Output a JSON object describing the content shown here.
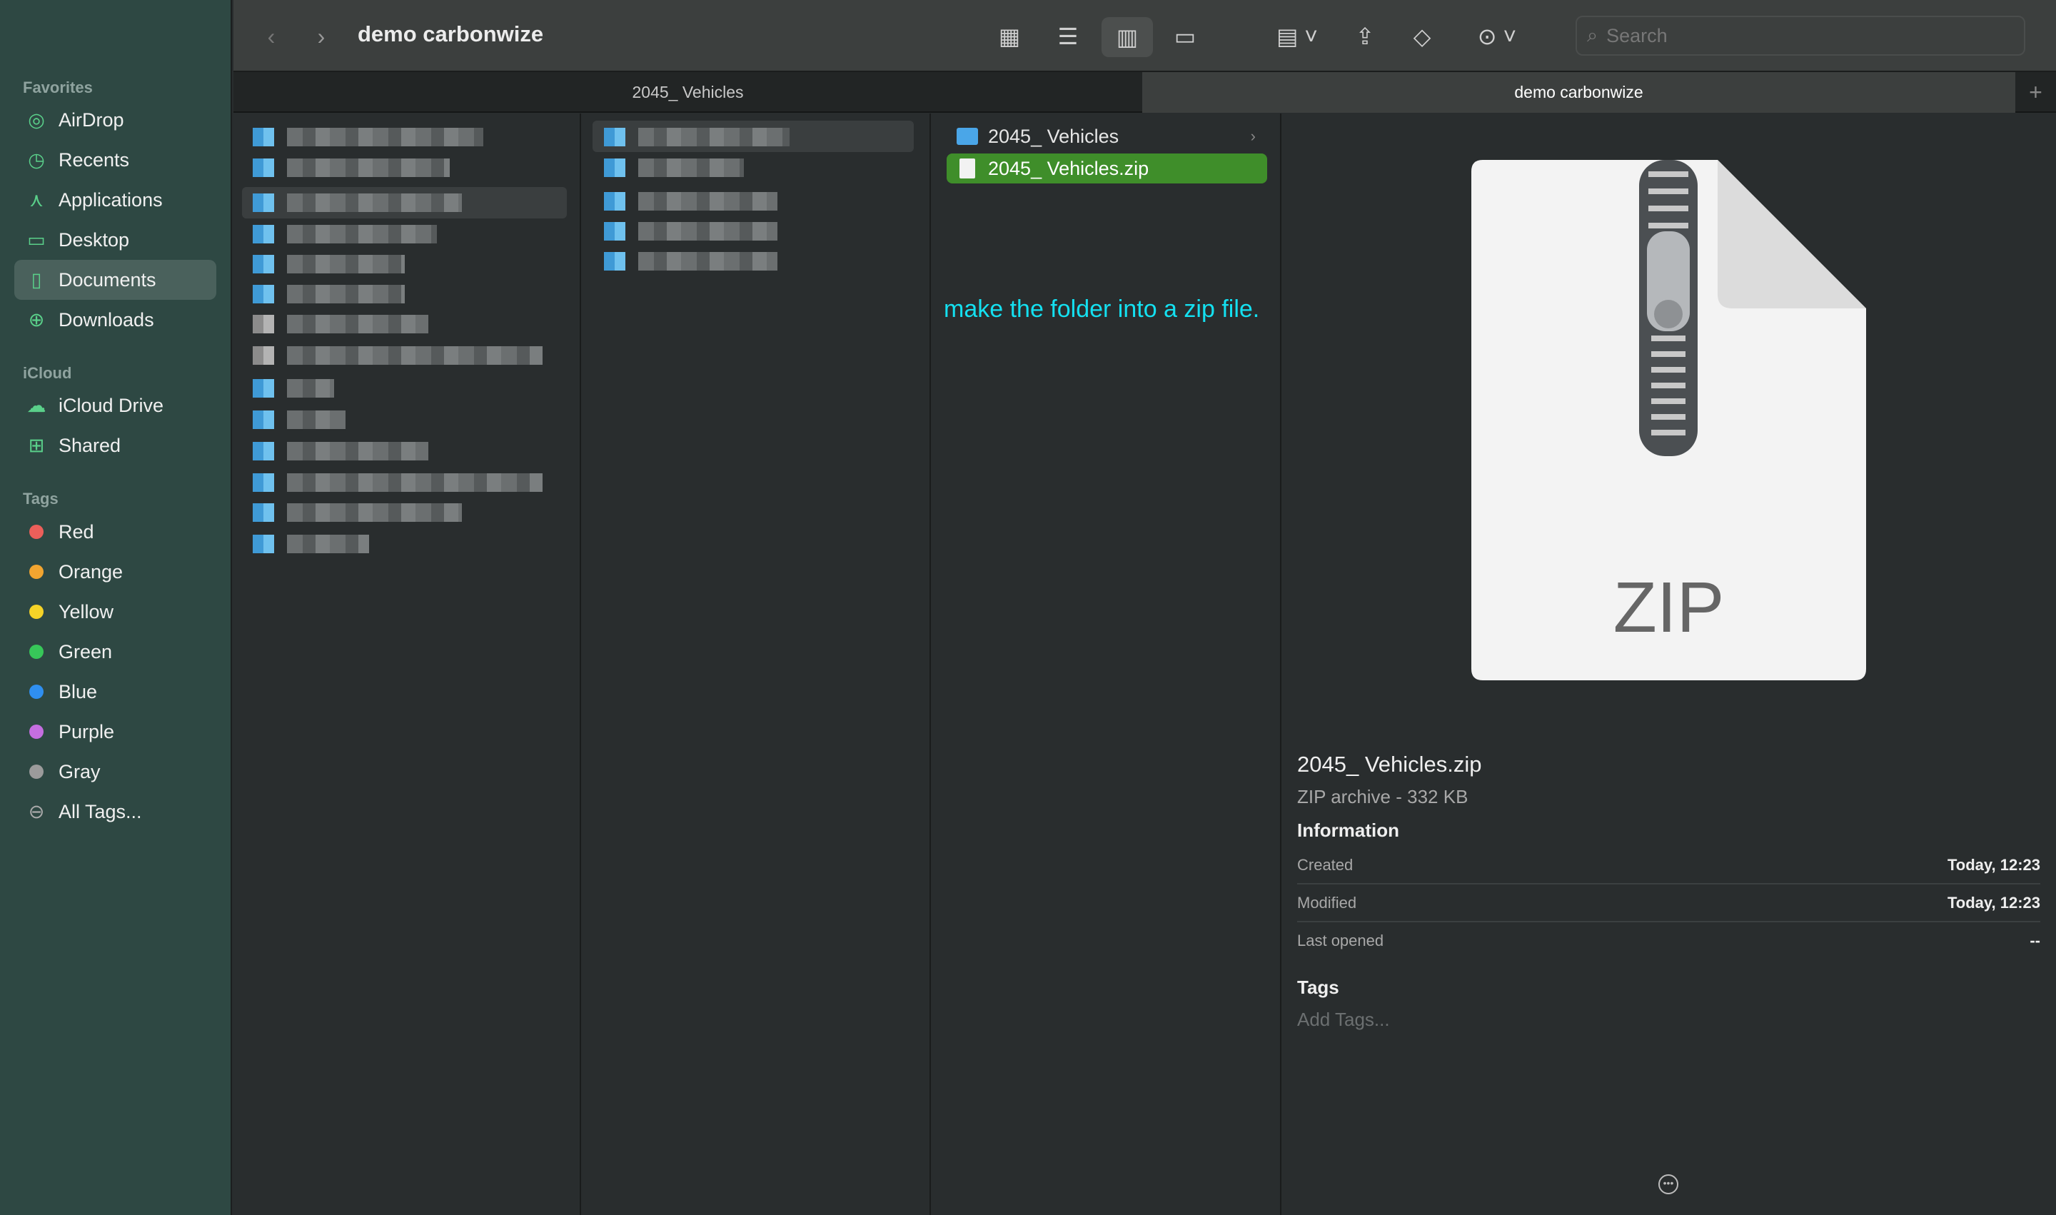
{
  "window": {
    "title": "demo carbonwize"
  },
  "sidebar": {
    "favorites_header": "Favorites",
    "favorites": [
      {
        "label": "AirDrop"
      },
      {
        "label": "Recents"
      },
      {
        "label": "Applications"
      },
      {
        "label": "Desktop"
      },
      {
        "label": "Documents",
        "selected": true
      },
      {
        "label": "Downloads"
      }
    ],
    "icloud_header": "iCloud",
    "icloud": [
      {
        "label": "iCloud Drive"
      },
      {
        "label": "Shared"
      }
    ],
    "tags_header": "Tags",
    "tags": [
      {
        "label": "Red",
        "color": "#ec5f5a"
      },
      {
        "label": "Orange",
        "color": "#f2a530"
      },
      {
        "label": "Yellow",
        "color": "#f5d327"
      },
      {
        "label": "Green",
        "color": "#37c759"
      },
      {
        "label": "Blue",
        "color": "#2f8ff0"
      },
      {
        "label": "Purple",
        "color": "#c46ee0"
      },
      {
        "label": "Gray",
        "color": "#9b9b9b"
      },
      {
        "label": "All Tags..."
      }
    ]
  },
  "toolbar": {
    "search_placeholder": "Search"
  },
  "tabs": [
    {
      "label": "2045_ Vehicles"
    },
    {
      "label": "demo carbonwize",
      "active": true
    }
  ],
  "column3": {
    "items": [
      {
        "label": "2045_ Vehicles",
        "type": "folder"
      },
      {
        "label": "2045_ Vehicles.zip",
        "type": "zip",
        "selected": true
      }
    ]
  },
  "annotation": "make the folder into a zip file.",
  "preview": {
    "icon_label": "ZIP",
    "name": "2045_ Vehicles.zip",
    "kind": "ZIP archive - 332 KB",
    "info_header": "Information",
    "info": [
      {
        "label": "Created",
        "value": "Today, 12:23"
      },
      {
        "label": "Modified",
        "value": "Today, 12:23"
      },
      {
        "label": "Last opened",
        "value": "--"
      }
    ],
    "tags_header": "Tags",
    "tags_placeholder": "Add Tags..."
  }
}
